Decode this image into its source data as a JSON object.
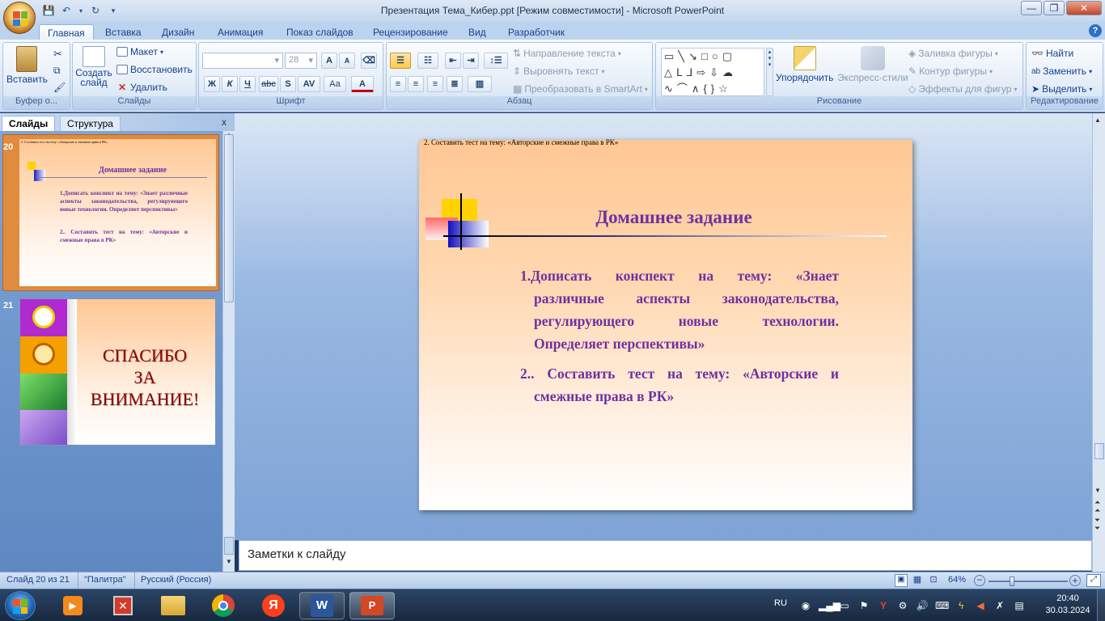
{
  "window": {
    "title": "Презентация Тема_Кибер.ppt [Режим совместимости] - Microsoft PowerPoint",
    "min": "—",
    "max": "❐",
    "close": "✕"
  },
  "qat": {
    "save_icon": "save-icon",
    "undo_icon": "undo-icon",
    "redo_icon": "redo-icon",
    "customize_icon": "dropdown-icon"
  },
  "ribbon_tabs": [
    "Главная",
    "Вставка",
    "Дизайн",
    "Анимация",
    "Показ слайдов",
    "Рецензирование",
    "Вид",
    "Разработчик"
  ],
  "ribbon": {
    "clipboard": {
      "label": "Буфер о...",
      "paste": "Вставить"
    },
    "slides": {
      "label": "Слайды",
      "new_slide": "Создать слайд",
      "layout": "Макет",
      "reset": "Восстановить",
      "delete": "Удалить"
    },
    "font": {
      "label": "Шрифт",
      "font_size": "28",
      "bold": "Ж",
      "italic": "К",
      "underline": "Ч",
      "strike": "abc",
      "shadow": "S",
      "spacing": "AV",
      "case": "Aa",
      "color": "A",
      "grow": "A",
      "shrink": "A"
    },
    "paragraph": {
      "label": "Абзац",
      "text_direction": "Направление текста",
      "align_text": "Выровнять текст",
      "smartart": "Преобразовать в SmartArt"
    },
    "drawing": {
      "label": "Рисование",
      "arrange": "Упорядочить",
      "quick_styles": "Экспресс-стили",
      "fill": "Заливка фигуры",
      "outline": "Контур фигуры",
      "effects": "Эффекты для фигур"
    },
    "editing": {
      "label": "Редактирование",
      "find": "Найти",
      "replace": "Заменить",
      "select": "Выделить"
    }
  },
  "pane": {
    "tabs": [
      "Слайды",
      "Структура"
    ],
    "close": "x",
    "slides": [
      {
        "number": "20",
        "header": "2. Составить тест на тему: «Авторские и смежные права в РК»",
        "title": "Домашнее задание",
        "item1": "1.Дописать конспект на тему: «Знает различные аспекты законодательства, регулирующего новые технологии. Определяет перспективы»",
        "item2": "2.. Составить тест на тему: «Авторские и смежные права в РК»"
      },
      {
        "number": "21",
        "text_line1": "СПАСИБО",
        "text_line2": "ЗА",
        "text_line3": "ВНИМАНИЕ!"
      }
    ]
  },
  "slide": {
    "header": "2. Составить тест на тему: «Авторские и смежные права в РК»",
    "title": "Домашнее задание",
    "item1_line1": "1.Дописать конспект на тему: «Знает",
    "item1_line2": "различные аспекты законодательства,",
    "item1_line3": "регулирующего новые технологии.",
    "item1_line4": "Определяет перспективы»",
    "item2_line1": "2.. Составить тест на тему: «Авторские и",
    "item2_line2": "смежные права в РК»"
  },
  "notes": {
    "placeholder": "Заметки к слайду"
  },
  "status": {
    "slide_counter": "Слайд 20 из 21",
    "theme": "\"Палитра\"",
    "language": "Русский (Россия)",
    "zoom": "64%",
    "zoom_level": 0.64
  },
  "taskbar": {
    "lang": "RU",
    "time": "20:40",
    "date": "30.03.2024",
    "apps": [
      "media-player-icon",
      "paint-icon",
      "file-explorer-icon",
      "chrome-icon",
      "yandex-icon",
      "word-icon",
      "powerpoint-icon"
    ]
  },
  "colors": {
    "accent": "#15428b",
    "slide_text": "#7030a0",
    "thanks_text": "#8b0000"
  }
}
